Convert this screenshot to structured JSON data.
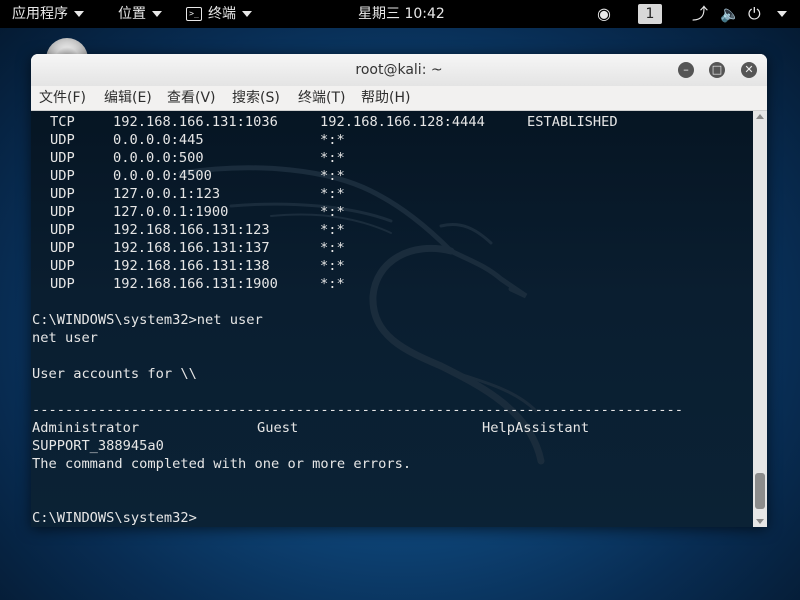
{
  "topbar": {
    "apps_label": "应用程序",
    "places_label": "位置",
    "terminal_label": "终端",
    "clock": "星期三 10:42",
    "workspace": "1"
  },
  "window": {
    "title": "root@kali: ~",
    "menus": [
      "文件(F)",
      "编辑(E)",
      "查看(V)",
      "搜索(S)",
      "终端(T)",
      "帮助(H)"
    ]
  },
  "terminal": {
    "connections": [
      {
        "proto": "TCP",
        "local": "192.168.166.131:1036",
        "foreign": "192.168.166.128:4444",
        "state": "ESTABLISHED"
      },
      {
        "proto": "UDP",
        "local": "0.0.0.0:445",
        "foreign": "*:*",
        "state": ""
      },
      {
        "proto": "UDP",
        "local": "0.0.0.0:500",
        "foreign": "*:*",
        "state": ""
      },
      {
        "proto": "UDP",
        "local": "0.0.0.0:4500",
        "foreign": "*:*",
        "state": ""
      },
      {
        "proto": "UDP",
        "local": "127.0.0.1:123",
        "foreign": "*:*",
        "state": ""
      },
      {
        "proto": "UDP",
        "local": "127.0.0.1:1900",
        "foreign": "*:*",
        "state": ""
      },
      {
        "proto": "UDP",
        "local": "192.168.166.131:123",
        "foreign": "*:*",
        "state": ""
      },
      {
        "proto": "UDP",
        "local": "192.168.166.131:137",
        "foreign": "*:*",
        "state": ""
      },
      {
        "proto": "UDP",
        "local": "192.168.166.131:138",
        "foreign": "*:*",
        "state": ""
      },
      {
        "proto": "UDP",
        "local": "192.168.166.131:1900",
        "foreign": "*:*",
        "state": ""
      }
    ],
    "prompt_cmd": "C:\\WINDOWS\\system32>net user",
    "echo": "net user",
    "accounts_header": "User accounts for \\\\",
    "separator": "-------------------------------------------------------------------------------",
    "accounts": [
      "Administrator",
      "Guest",
      "HelpAssistant",
      "SUPPORT_388945a0"
    ],
    "completion": "The command completed with one or more errors.",
    "final_prompt": "C:\\WINDOWS\\system32>"
  }
}
